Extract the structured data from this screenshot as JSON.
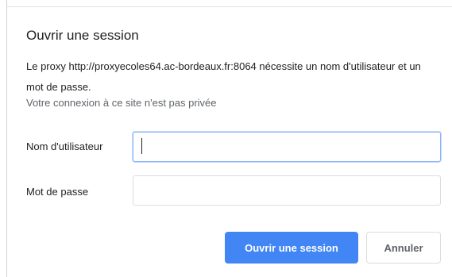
{
  "dialog": {
    "title": "Ouvrir une session",
    "message": "Le proxy http://proxyecoles64.ac-bordeaux.fr:8064 nécessite un nom d'utilisateur et un mot de passe.",
    "privacy_note": "Votre connexion à ce site n'est pas privée"
  },
  "form": {
    "username": {
      "label": "Nom d'utilisateur",
      "value": ""
    },
    "password": {
      "label": "Mot de passe",
      "value": ""
    }
  },
  "buttons": {
    "submit_label": "Ouvrir une session",
    "cancel_label": "Annuler"
  },
  "colors": {
    "primary": "#4285f4",
    "focus_border": "#8ab4f8"
  }
}
